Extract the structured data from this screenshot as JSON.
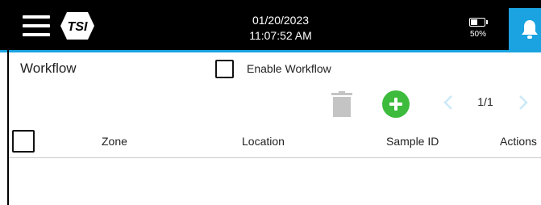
{
  "header": {
    "date": "01/20/2023",
    "time": "11:07:52 AM",
    "battery_percent": "50%",
    "accent_color": "#1aa3e0",
    "icons": [
      "hamburger-menu-icon",
      "tsi-logo",
      "battery-icon",
      "bell-icon"
    ]
  },
  "page": {
    "title": "Workflow",
    "enable_label": "Enable Workflow",
    "enable_checked": false
  },
  "toolbar": {
    "page_indicator": "1/1",
    "icons": [
      "trash-icon",
      "add-icon",
      "chevron-left-icon",
      "chevron-right-icon"
    ],
    "add_color": "#3dbb3d"
  },
  "table": {
    "columns": [
      "Zone",
      "Location",
      "Sample ID",
      "Actions"
    ],
    "rows": []
  }
}
